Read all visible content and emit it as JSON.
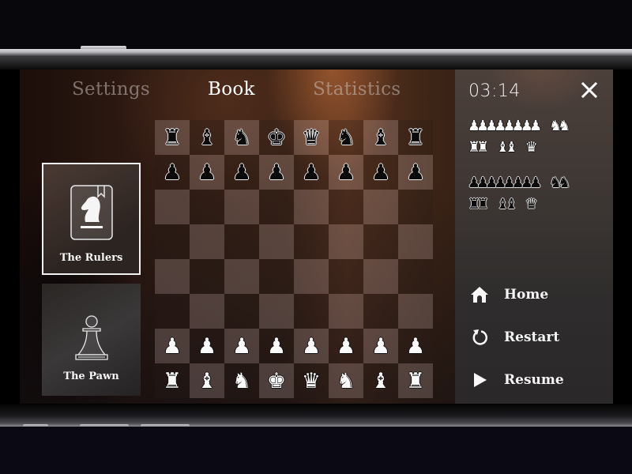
{
  "tabs": [
    {
      "label": "Settings",
      "active": false
    },
    {
      "label": "Book",
      "active": true
    },
    {
      "label": "Statistics",
      "active": false
    }
  ],
  "book_cards": [
    {
      "label": "The Rulers",
      "icon": "book-knight-icon",
      "selected": true
    },
    {
      "label": "The Pawn",
      "icon": "pawn-outline-icon",
      "selected": false
    }
  ],
  "board": {
    "rows": [
      [
        {
          "p": "♜",
          "c": "black"
        },
        {
          "p": "♝",
          "c": "black"
        },
        {
          "p": "♞",
          "c": "black"
        },
        {
          "p": "♚",
          "c": "black"
        },
        {
          "p": "♛",
          "c": "black"
        },
        {
          "p": "♞",
          "c": "black"
        },
        {
          "p": "♝",
          "c": "black"
        },
        {
          "p": "♜",
          "c": "black"
        }
      ],
      [
        {
          "p": "♟",
          "c": "black"
        },
        {
          "p": "♟",
          "c": "black"
        },
        {
          "p": "♟",
          "c": "black"
        },
        {
          "p": "♟",
          "c": "black"
        },
        {
          "p": "♟",
          "c": "black"
        },
        {
          "p": "♟",
          "c": "black"
        },
        {
          "p": "♟",
          "c": "black"
        },
        {
          "p": "♟",
          "c": "black"
        }
      ],
      [
        null,
        null,
        null,
        null,
        null,
        null,
        null,
        null
      ],
      [
        null,
        null,
        null,
        null,
        null,
        null,
        null,
        null
      ],
      [
        null,
        null,
        null,
        null,
        null,
        null,
        null,
        null
      ],
      [
        null,
        null,
        null,
        null,
        null,
        null,
        null,
        null
      ],
      [
        {
          "p": "♟",
          "c": "white"
        },
        {
          "p": "♟",
          "c": "white"
        },
        {
          "p": "♟",
          "c": "white"
        },
        {
          "p": "♟",
          "c": "white"
        },
        {
          "p": "♟",
          "c": "white"
        },
        {
          "p": "♟",
          "c": "white"
        },
        {
          "p": "♟",
          "c": "white"
        },
        {
          "p": "♟",
          "c": "white"
        }
      ],
      [
        {
          "p": "♜",
          "c": "white"
        },
        {
          "p": "♝",
          "c": "white"
        },
        {
          "p": "♞",
          "c": "white"
        },
        {
          "p": "♚",
          "c": "white"
        },
        {
          "p": "♛",
          "c": "white"
        },
        {
          "p": "♞",
          "c": "white"
        },
        {
          "p": "♝",
          "c": "white"
        },
        {
          "p": "♜",
          "c": "white"
        }
      ]
    ]
  },
  "panel": {
    "timer": "03:14",
    "close_icon": "close-icon",
    "captured_white": {
      "row1": [
        {
          "glyph": "♟",
          "count": 8
        },
        {
          "glyph": "♞",
          "count": 2
        }
      ],
      "row2": [
        {
          "glyph": "♜",
          "count": 2
        },
        {
          "glyph": "♝",
          "count": 2
        },
        {
          "glyph": "♛",
          "count": 1
        }
      ]
    },
    "captured_black": {
      "row1": [
        {
          "glyph": "♟",
          "count": 8
        },
        {
          "glyph": "♞",
          "count": 2
        }
      ],
      "row2": [
        {
          "glyph": "♜",
          "count": 2
        },
        {
          "glyph": "♝",
          "count": 2
        },
        {
          "glyph": "♛",
          "count": 1
        }
      ]
    },
    "menu": [
      {
        "label": "Home",
        "icon": "home-icon"
      },
      {
        "label": "Restart",
        "icon": "restart-icon"
      },
      {
        "label": "Resume",
        "icon": "play-icon"
      }
    ]
  }
}
